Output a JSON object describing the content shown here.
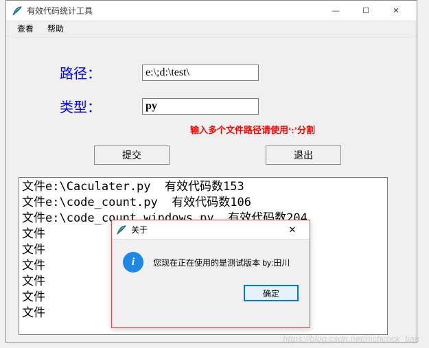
{
  "window": {
    "title": "有效代码统计工具",
    "controls": {
      "min": "—",
      "max": "☐",
      "close": "✕"
    }
  },
  "menu": {
    "view": "查看",
    "help": "帮助"
  },
  "form": {
    "path_label": "路径：",
    "path_value": "e:\\;d:\\test\\",
    "type_label": "类型：",
    "type_value": "py",
    "hint": "输入多个文件路径请使用‘:’分割"
  },
  "buttons": {
    "submit": "提交",
    "exit": "退出"
  },
  "output_lines": [
    "文件e:\\Caculater.py  有效代码数153",
    "文件e:\\code_count.py  有效代码数106",
    "文件e:\\code_count_windows.py  有效代码数204",
    "文件",
    "文件",
    "文件",
    "文件",
    "文件",
    "文件"
  ],
  "dialog": {
    "title": "关于",
    "message": "您现在正在使用的是测试版本  by:田川",
    "ok": "确定",
    "close": "✕"
  },
  "watermark": "https://blog.csdn.net/nichcock_tian"
}
